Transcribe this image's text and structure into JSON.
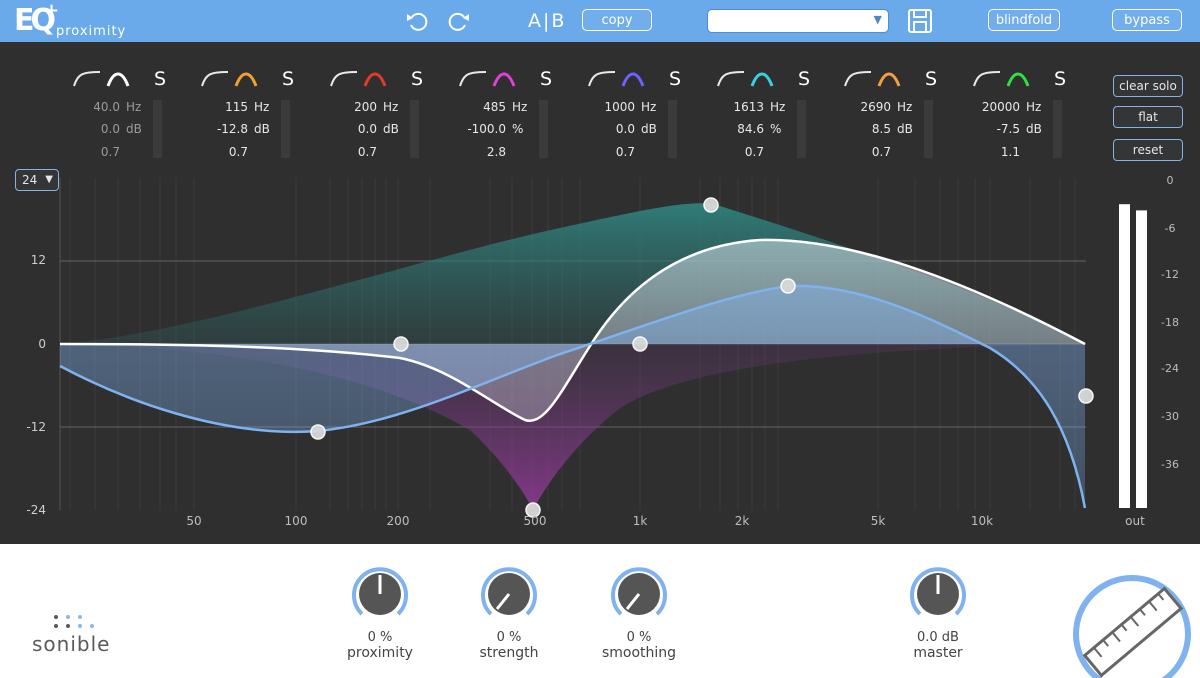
{
  "app": {
    "logo_text": "EQ",
    "logo_plus": "+",
    "logo_subtitle": "proximity"
  },
  "toolbar": {
    "ab_label": "A|B",
    "copy_label": "copy",
    "preset_value": "",
    "blind_label": "blindfold",
    "bypass_label": "bypass"
  },
  "bands": [
    {
      "freq": "40.0",
      "freq_unit": "Hz",
      "gain": "0.0",
      "gain_unit": "dB",
      "q": "0.7",
      "solo": "S",
      "color": "#ffffff",
      "dim": true
    },
    {
      "freq": "115",
      "freq_unit": "Hz",
      "gain": "-12.8",
      "gain_unit": "dB",
      "q": "0.7",
      "solo": "S",
      "color": "#f0a030",
      "dim": false
    },
    {
      "freq": "200",
      "freq_unit": "Hz",
      "gain": "0.0",
      "gain_unit": "dB",
      "q": "0.7",
      "solo": "S",
      "color": "#e03b2b",
      "dim": false
    },
    {
      "freq": "485",
      "freq_unit": "Hz",
      "gain": "-100.0",
      "gain_unit": "%",
      "q": "2.8",
      "solo": "S",
      "color": "#e040d8",
      "dim": false
    },
    {
      "freq": "1000",
      "freq_unit": "Hz",
      "gain": "0.0",
      "gain_unit": "dB",
      "q": "0.7",
      "solo": "S",
      "color": "#6b62ff",
      "dim": false
    },
    {
      "freq": "1613",
      "freq_unit": "Hz",
      "gain": "84.6",
      "gain_unit": "%",
      "q": "0.7",
      "solo": "S",
      "color": "#38d0e0",
      "dim": false
    },
    {
      "freq": "2690",
      "freq_unit": "Hz",
      "gain": "8.5",
      "gain_unit": "dB",
      "q": "0.7",
      "solo": "S",
      "color": "#f0a040",
      "dim": false
    },
    {
      "freq": "20000",
      "freq_unit": "Hz",
      "gain": "-7.5",
      "gain_unit": "dB",
      "q": "1.1",
      "solo": "S",
      "color": "#30e040",
      "dim": false
    }
  ],
  "side_buttons": {
    "clear_solo": "clear solo",
    "flat": "flat",
    "reset": "reset"
  },
  "range_select": {
    "value": "24"
  },
  "graph": {
    "y_labels": [
      "12",
      "0",
      "-12",
      "-24"
    ],
    "x_labels": [
      "50",
      "100",
      "200",
      "500",
      "1k",
      "2k",
      "5k",
      "10k"
    ],
    "meter_labels": [
      "0",
      "-6",
      "-12",
      "-18",
      "-24",
      "-30",
      "-36"
    ],
    "out_label": "out",
    "output_levels": [
      0.98,
      0.96
    ]
  },
  "knobs": [
    {
      "value": "0 %",
      "label": "proximity"
    },
    {
      "value": "0 %",
      "label": "strength"
    },
    {
      "value": "0 %",
      "label": "smoothing"
    },
    {
      "value": "0.0 dB",
      "label": "master"
    }
  ],
  "brand": {
    "name": "sonible"
  },
  "colors": {
    "accent": "#6aa9ea",
    "background": "#2f2f30",
    "curve_white": "#ffffff",
    "curve_blue": "#7fb2ee"
  }
}
